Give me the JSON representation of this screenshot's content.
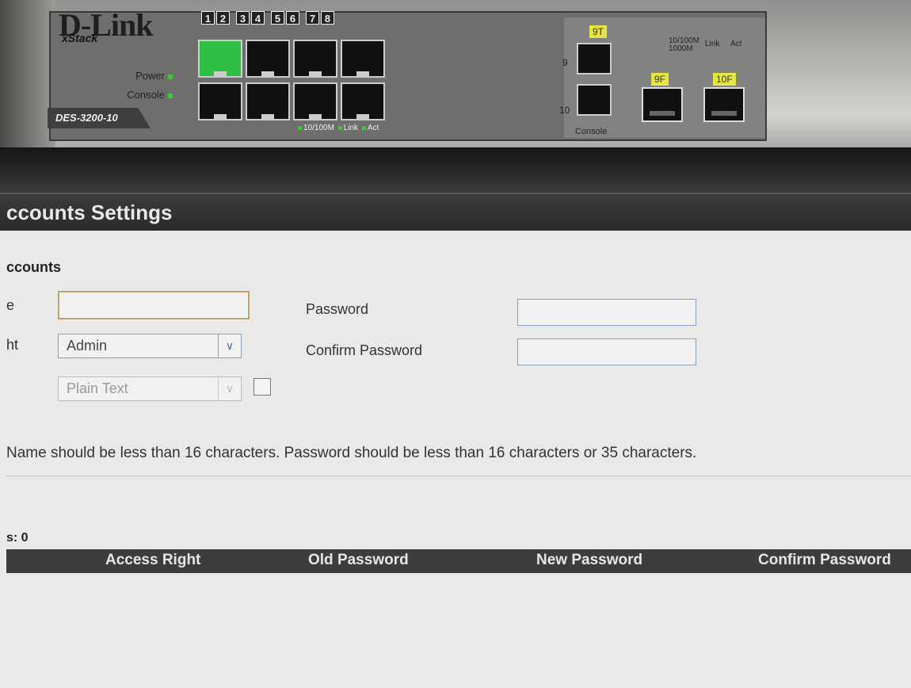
{
  "device": {
    "brand": "D-Link",
    "series": "xStack",
    "model": "DES-3200-10",
    "port_numbers": [
      "1",
      "2",
      "3",
      "4",
      "5",
      "6",
      "7",
      "8"
    ],
    "led_labels": {
      "power": "Power",
      "console": "Console"
    },
    "legend": {
      "speed": "10/100M",
      "link": "Link",
      "act": "Act"
    },
    "combo": {
      "copper_label": "9T",
      "fiber_label_9": "9F",
      "fiber_label_10": "10F",
      "speed_top": "10/100M",
      "speed_bottom": "1000M",
      "link": "Link",
      "act": "Act",
      "port9": "9",
      "port10": "10",
      "console": "Console"
    },
    "active_port": 1,
    "colors": {
      "active_port": "#2fbf45",
      "led": "#33cc33",
      "label_yellow": "#e5e544"
    }
  },
  "page": {
    "title": "ccounts Settings",
    "section_heading": "ccounts",
    "labels": {
      "username_fragment": "e",
      "access_right_fragment": "ht",
      "password": "Password",
      "confirm_password": "Confirm Password"
    },
    "inputs": {
      "username_value": "",
      "password_value": "",
      "confirm_password_value": ""
    },
    "access_right_select": {
      "value": "Admin"
    },
    "encryption_select": {
      "value": "Plain Text",
      "disabled": true
    },
    "encrypt_checkbox": {
      "checked": false
    },
    "note": "Name should be less than 16 characters. Password should be less than 16 characters or 35 characters.",
    "total_label": "s: 0",
    "table": {
      "columns": [
        "Access Right",
        "Old Password",
        "New Password",
        "Confirm Password"
      ]
    }
  }
}
